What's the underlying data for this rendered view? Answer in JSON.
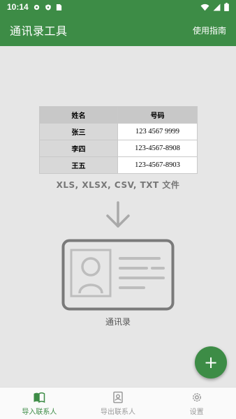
{
  "status_bar": {
    "time": "10:14"
  },
  "app_bar": {
    "title": "通讯录工具",
    "guide_label": "使用指南"
  },
  "sample_table": {
    "headers": [
      "姓名",
      "号码"
    ],
    "rows": [
      {
        "name": "张三",
        "phone": "123 4567 9999"
      },
      {
        "name": "李四",
        "phone": "123-4567-8908"
      },
      {
        "name": "王五",
        "phone": "123-4567-8903"
      }
    ]
  },
  "formats_text": "XLS, XLSX, CSV, TXT 文件",
  "card_label": "通讯录",
  "fab": {
    "icon": "plus-icon",
    "label": "+"
  },
  "bottom_nav": {
    "items": [
      {
        "label": "导入联系人",
        "icon": "book-icon",
        "active": true
      },
      {
        "label": "导出联系人",
        "icon": "contact-card-icon",
        "active": false
      },
      {
        "label": "设置",
        "icon": "gear-icon",
        "active": false
      }
    ]
  },
  "colors": {
    "primary": "#3d8c46",
    "background": "#e6e6e6",
    "inactive": "#9a9a9a"
  }
}
